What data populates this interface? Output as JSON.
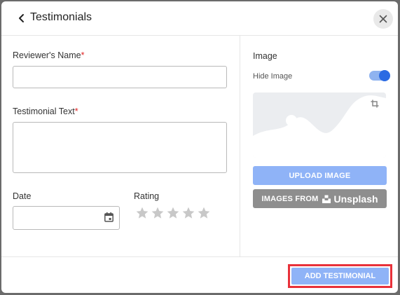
{
  "modal": {
    "title": "Testimonials",
    "back_icon": "chevron-left-icon",
    "close_icon": "close-icon"
  },
  "form": {
    "reviewer_name_label": "Reviewer's Name",
    "reviewer_name_value": "",
    "testimonial_text_label": "Testimonial Text",
    "testimonial_text_value": "",
    "required_marker": "*",
    "date_label": "Date",
    "date_value": "",
    "rating_label": "Rating",
    "rating_value": 0,
    "rating_max": 5
  },
  "image": {
    "section_label": "Image",
    "hide_image_label": "Hide Image",
    "hide_image_toggle_on": true,
    "upload_button_label": "UPLOAD IMAGE",
    "unsplash_button_prefix": "IMAGES FROM",
    "unsplash_brand": "Unsplash"
  },
  "footer": {
    "add_button_label": "ADD TESTIMONIAL"
  },
  "colors": {
    "primary_light": "#8fb3f7",
    "toggle_knob": "#2b6be3",
    "required": "#e02424",
    "highlight_border": "#e8313a",
    "unsplash_button": "#8e8e8e",
    "star_empty": "#c8c8c8"
  }
}
